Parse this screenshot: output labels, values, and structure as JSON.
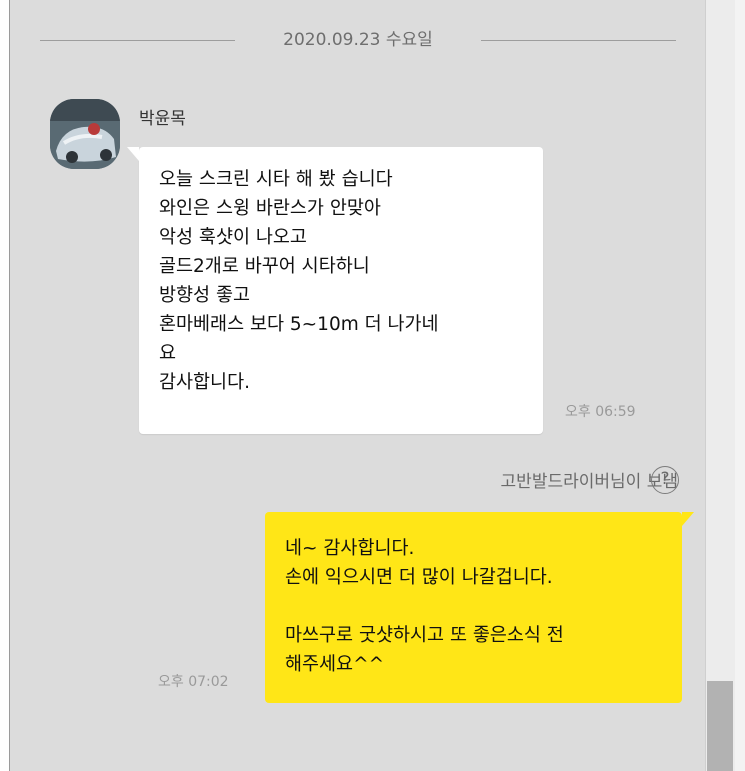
{
  "date_divider": "2020.09.23 수요일",
  "incoming": {
    "sender": "박윤목",
    "lines": [
      "오늘 스크린 시타 해 봤 습니다",
      "와인은 스윙 바란스가 안맞아",
      "악성 훅샷이 나오고",
      "골드2개로 바꾸어 시타하니",
      "방향성 좋고",
      "혼마베래스 보다 5~10m 더 나가네",
      "요",
      "감사합니다."
    ],
    "time": "오후 06:59",
    "sent_by": "고반발드라이버님이 보냄",
    "help_icon": "help-icon"
  },
  "outgoing": {
    "lines": [
      "네~ 감사합니다.",
      "손에 익으시면 더 많이 나갈겁니다.",
      "",
      "마쓰구로 굿샷하시고 또 좋은소식 전",
      "해주세요^^"
    ],
    "time": "오후 07:02"
  },
  "colors": {
    "chat_bg": "#dcdcdc",
    "incoming_bubble": "#ffffff",
    "outgoing_bubble": "#ffe617"
  }
}
